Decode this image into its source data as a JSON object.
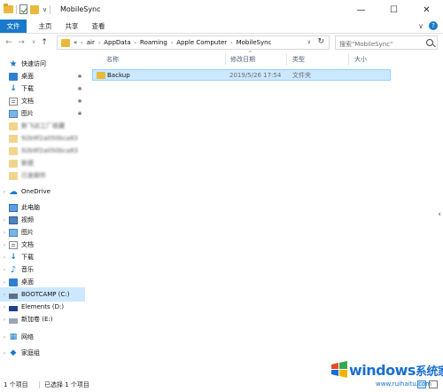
{
  "window": {
    "title": "MobileSync",
    "minimize_glyph": "—",
    "maximize_glyph": "☐",
    "close_glyph": "✕"
  },
  "ribbon": {
    "tabs": [
      "文件",
      "主页",
      "共享",
      "查看"
    ],
    "collapse_glyph": "∨",
    "help_glyph": "?"
  },
  "navigation": {
    "back_glyph": "←",
    "forward_glyph": "→",
    "recent_glyph": "∨",
    "up_glyph": "↑"
  },
  "address": {
    "overflow": "«",
    "crumbs": [
      "air",
      "AppData",
      "Roaming",
      "Apple Computer",
      "MobileSync"
    ],
    "separator": "›",
    "dropdown_glyph": "∨",
    "refresh_glyph": "↻"
  },
  "search": {
    "placeholder": "搜索\"MobileSync\""
  },
  "sidebar": {
    "quick_access": "快速访问",
    "items": [
      {
        "label": "桌面",
        "icon": "desktop-icon",
        "pinned": true
      },
      {
        "label": "下载",
        "icon": "download-icon",
        "pinned": true
      },
      {
        "label": "文档",
        "icon": "documents-icon",
        "pinned": true
      },
      {
        "label": "图片",
        "icon": "pictures-icon",
        "pinned": true
      },
      {
        "label": "新飞达工厂收藏",
        "icon": "folder-icon",
        "pinned": false,
        "blurred": true
      },
      {
        "label": "92b9f2a050bca83",
        "icon": "folder-icon",
        "pinned": false,
        "blurred": true
      },
      {
        "label": "92b9f2a050bca83",
        "icon": "folder-icon",
        "pinned": false,
        "blurred": true
      },
      {
        "label": "新建",
        "icon": "folder-icon",
        "pinned": false,
        "blurred": true
      },
      {
        "label": "已发邮件",
        "icon": "folder-icon",
        "pinned": false,
        "blurred": true
      }
    ],
    "onedrive": "OneDrive",
    "this_pc": "此电脑",
    "pc_items": [
      {
        "label": "视频",
        "icon": "videos-icon"
      },
      {
        "label": "图片",
        "icon": "pictures-icon"
      },
      {
        "label": "文档",
        "icon": "documents-icon"
      },
      {
        "label": "下载",
        "icon": "download-icon"
      },
      {
        "label": "音乐",
        "icon": "music-icon"
      },
      {
        "label": "桌面",
        "icon": "desktop-icon"
      },
      {
        "label": "BOOTCAMP (C:)",
        "icon": "drive-icon",
        "selected": true
      },
      {
        "label": "Elements (D:)",
        "icon": "drive-icon"
      },
      {
        "label": "新加卷 (E:)",
        "icon": "drive-icon"
      }
    ],
    "network": "网络",
    "homegroup": "家庭组",
    "expand_glyph": "›",
    "pin_glyph": "✱"
  },
  "columns": {
    "name": "名称",
    "date": "修改日期",
    "type": "类型",
    "size": "大小",
    "sort_glyph": "^"
  },
  "files": [
    {
      "name": "Backup",
      "date": "2019/5/26 17:54",
      "type": "文件夹",
      "size": ""
    }
  ],
  "side_arrow_glyph": "‹",
  "status": {
    "count": "1 个项目",
    "selected": "已选择 1 个项目"
  },
  "watermark": {
    "brand": "windows",
    "brand_cn": "系统家园",
    "url": "www.ruihaitu.com"
  }
}
